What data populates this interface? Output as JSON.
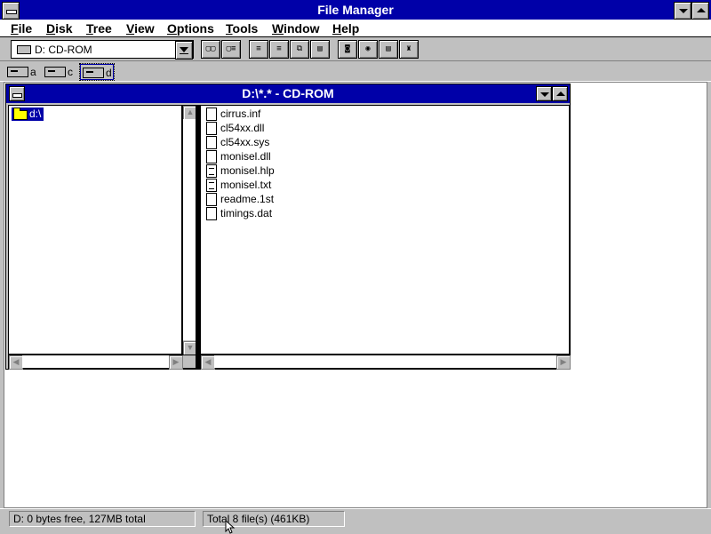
{
  "window": {
    "title": "File Manager"
  },
  "menu": [
    {
      "label": "File",
      "accel": "F",
      "rest": "ile"
    },
    {
      "label": "Disk",
      "accel": "D",
      "rest": "isk"
    },
    {
      "label": "Tree",
      "accel": "T",
      "rest": "ree"
    },
    {
      "label": "View",
      "accel": "V",
      "rest": "iew"
    },
    {
      "label": "Options",
      "accel": "O",
      "rest": "ptions"
    },
    {
      "label": "Tools",
      "accel": "T",
      "rest": "ools"
    },
    {
      "label": "Window",
      "accel": "W",
      "rest": "indow"
    },
    {
      "label": "Help",
      "accel": "H",
      "rest": "elp"
    }
  ],
  "toolbar": {
    "drive_select_value": "D: CD-ROM",
    "icons": [
      "connect-network-drive-icon",
      "disconnect-network-drive-icon",
      "sort-by-name-icon",
      "sort-by-type-icon",
      "copy-icon",
      "properties-icon",
      "disk-icon",
      "share-icon",
      "print-icon",
      "install-icon"
    ]
  },
  "drives": [
    {
      "letter": "a",
      "icon": "floppy-drive-icon"
    },
    {
      "letter": "c",
      "icon": "hard-drive-icon"
    },
    {
      "letter": "d",
      "icon": "cdrom-drive-icon",
      "selected": true
    }
  ],
  "child_window": {
    "title": "D:\\*.* - CD-ROM",
    "tree": {
      "items": [
        {
          "label": "d:\\",
          "selected": true
        }
      ]
    },
    "files": [
      {
        "name": "cirrus.inf",
        "icon": "file-icon"
      },
      {
        "name": "cl54xx.dll",
        "icon": "file-icon"
      },
      {
        "name": "cl54xx.sys",
        "icon": "file-icon"
      },
      {
        "name": "monisel.dll",
        "icon": "file-icon"
      },
      {
        "name": "monisel.hlp",
        "icon": "document-icon"
      },
      {
        "name": "monisel.txt",
        "icon": "document-icon"
      },
      {
        "name": "readme.1st",
        "icon": "file-icon"
      },
      {
        "name": "timings.dat",
        "icon": "file-icon"
      }
    ]
  },
  "status": {
    "drive_info": "D: 0 bytes free,  127MB total",
    "file_info": "Total 8 file(s) (461KB)"
  },
  "colors": {
    "titlebar": "#0000a8",
    "chrome": "#c0c0c0",
    "selection": "#0000a8"
  }
}
